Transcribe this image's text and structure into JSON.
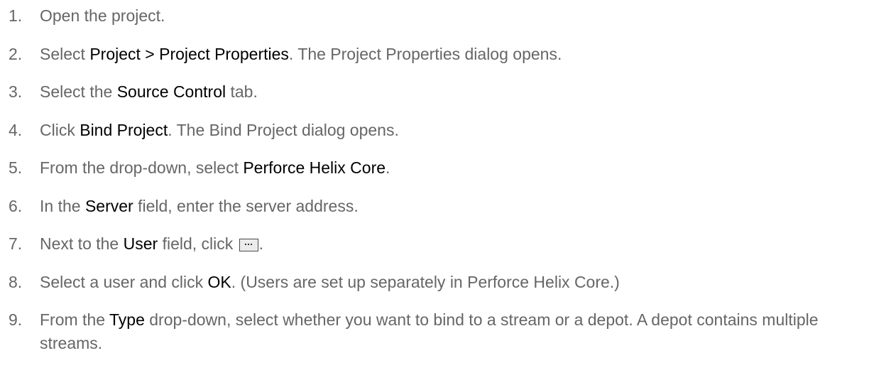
{
  "steps": [
    {
      "num": "1.",
      "parts": [
        "Open the project."
      ]
    },
    {
      "num": "2.",
      "parts": [
        "Select ",
        "Project > Project Properties",
        ". The Project Properties dialog opens."
      ]
    },
    {
      "num": "3.",
      "parts": [
        "Select the ",
        "Source Control",
        " tab."
      ]
    },
    {
      "num": "4.",
      "parts": [
        "Click ",
        "Bind Project",
        ". The Bind Project dialog opens."
      ]
    },
    {
      "num": "5.",
      "parts": [
        "From the drop-down, select ",
        "Perforce Helix Core",
        "."
      ]
    },
    {
      "num": "6.",
      "parts": [
        "In the ",
        "Server",
        " field, enter the server address."
      ]
    },
    {
      "num": "7.",
      "parts": [
        "Next to the ",
        "User",
        " field, click ",
        "."
      ]
    },
    {
      "num": "8.",
      "parts": [
        "Select a user and click ",
        "OK",
        ". (Users are set up separately in Perforce Helix Core.)"
      ]
    },
    {
      "num": "9.",
      "parts": [
        "From the ",
        "Type",
        " drop-down, select whether you want to bind to a stream or a depot. A depot contains multiple streams."
      ]
    }
  ],
  "icons": {
    "browse_button": "ellipsis-browse-icon"
  }
}
